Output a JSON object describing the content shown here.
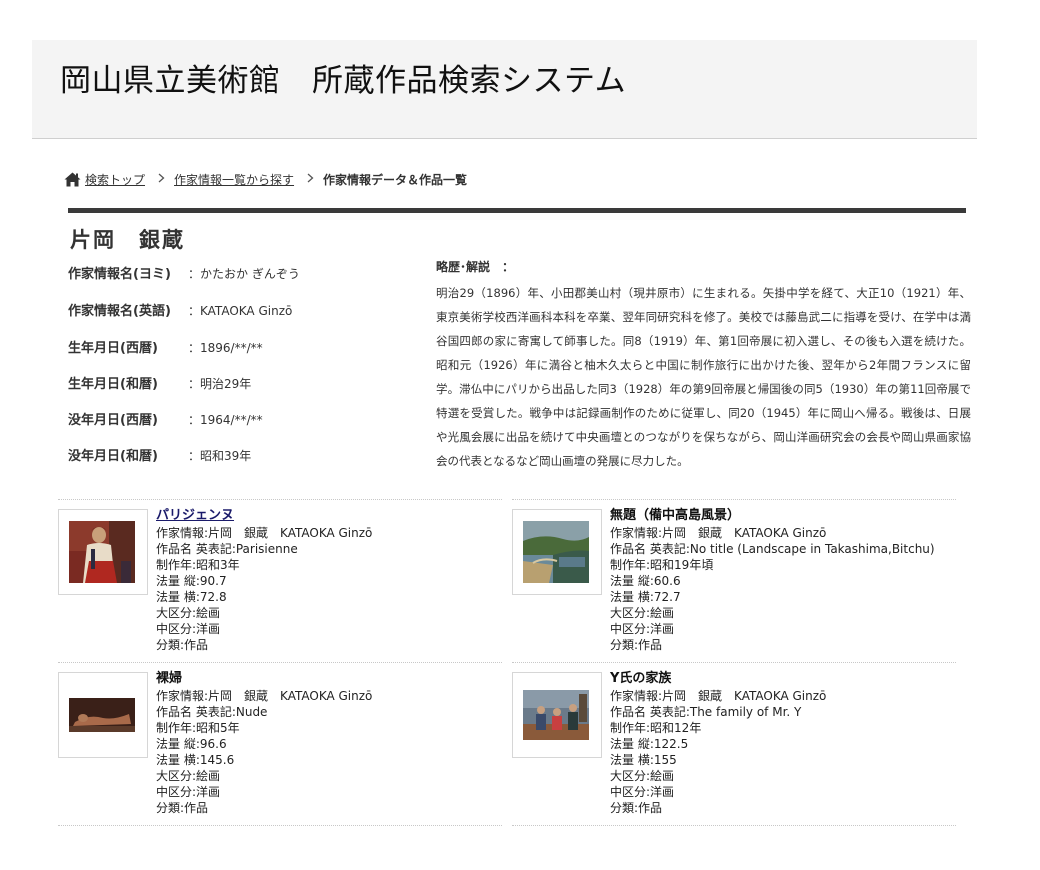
{
  "header": {
    "title": "岡山県立美術館　所蔵作品検索システム"
  },
  "breadcrumb": {
    "home": "検索トップ",
    "sep": "＞",
    "list": "作家情報一覧から探す",
    "current": "作家情報データ＆作品一覧"
  },
  "artist": {
    "name": "片岡　銀蔵",
    "fields": [
      {
        "label": "作家情報名(ヨミ)",
        "value": "：かたおか ぎんぞう"
      },
      {
        "label": "作家情報名(英語)",
        "value": "：KATAOKA Ginzō"
      },
      {
        "label": "生年月日(西暦)",
        "value": "：1896/**/**"
      },
      {
        "label": "生年月日(和暦)",
        "value": "：明治29年"
      },
      {
        "label": "没年月日(西暦)",
        "value": "：1964/**/**"
      },
      {
        "label": "没年月日(和暦)",
        "value": "：昭和39年"
      }
    ],
    "bio_title": "略歴･解説　：",
    "bio": "明治29（1896）年、小田郡美山村（現井原市）に生まれる。矢掛中学を経て、大正10（1921）年、東京美術学校西洋画科本科を卒業、翌年同研究科を修了。美校では藤島武二に指導を受け、在学中は満谷国四郎の家に寄寓して師事した。同8（1919）年、第1回帝展に初入選し、その後も入選を続けた。昭和元（1926）年に満谷と柚木久太らと中国に制作旅行に出かけた後、翌年から2年間フランスに留学。滞仏中にパリから出品した同3（1928）年の第9回帝展と帰国後の同5（1930）年の第11回帝展で特選を受賞した。戦争中は記録画制作のために従軍し、同20（1945）年に岡山へ帰る。戦後は、日展や光風会展に出品を続けて中央画壇とのつながりを保ちながら、岡山洋画研究会の会長や岡山県画家協会の代表となるなど岡山画壇の発展に尽力した。"
  },
  "works": [
    {
      "title": "パリジェンヌ",
      "lines": [
        "作家情報:片岡　銀蔵　KATAOKA Ginzō",
        "作品名 英表記:Parisienne",
        "制作年:昭和3年",
        "法量 縦:90.7",
        "法量 横:72.8",
        "大区分:絵画",
        "中区分:洋画",
        "分類:作品"
      ]
    },
    {
      "title": "無題（備中高島風景）",
      "lines": [
        "作家情報:片岡　銀蔵　KATAOKA Ginzō",
        "作品名 英表記:No title (Landscape in Takashima,Bitchu)",
        "制作年:昭和19年頃",
        "法量 縦:60.6",
        "法量 横:72.7",
        "大区分:絵画",
        "中区分:洋画",
        "分類:作品"
      ]
    },
    {
      "title": "裸婦",
      "lines": [
        "作家情報:片岡　銀蔵　KATAOKA Ginzō",
        "作品名 英表記:Nude",
        "制作年:昭和5年",
        "法量 縦:96.6",
        "法量 横:145.6",
        "大区分:絵画",
        "中区分:洋画",
        "分類:作品"
      ]
    },
    {
      "title": "Y氏の家族",
      "lines": [
        "作家情報:片岡　銀蔵　KATAOKA Ginzō",
        "作品名 英表記:The family of Mr. Y",
        "制作年:昭和12年",
        "法量 縦:122.5",
        "法量 横:155",
        "大区分:絵画",
        "中区分:洋画",
        "分類:作品"
      ]
    }
  ]
}
